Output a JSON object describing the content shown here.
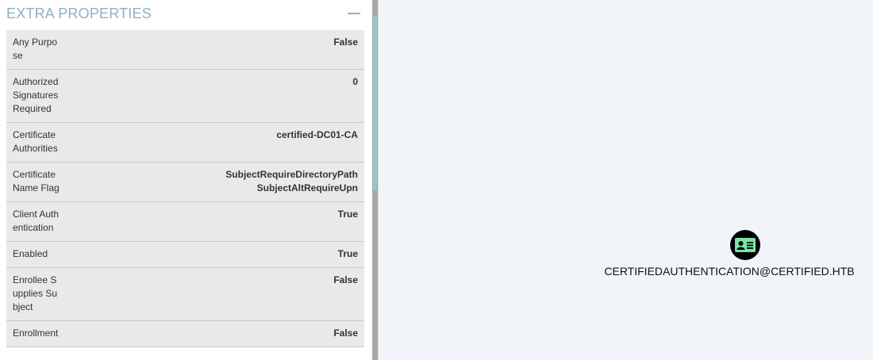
{
  "panel": {
    "section_title": "EXTRA PROPERTIES",
    "collapse_icon": "minus-icon",
    "properties": [
      {
        "key": "Any Purpose",
        "value": [
          "False"
        ]
      },
      {
        "key": "Authorized Signatures Required",
        "value": [
          "0"
        ]
      },
      {
        "key": "Certificate Authorities",
        "value": [
          "certified-DC01-CA"
        ]
      },
      {
        "key": "Certificate Name Flag",
        "value": [
          "SubjectRequireDirectoryPath",
          "SubjectAltRequireUpn"
        ]
      },
      {
        "key": "Client Authentication",
        "value": [
          "True"
        ]
      },
      {
        "key": "Enabled",
        "value": [
          "True"
        ]
      },
      {
        "key": "Enrollee Supplies Subject",
        "value": [
          "False"
        ]
      },
      {
        "key": "Enrollment",
        "value": [
          "False"
        ]
      }
    ]
  },
  "graph": {
    "node": {
      "icon": "id-card-icon",
      "icon_color": "#7be3a4",
      "background": "#000000",
      "label": "CERTIFIEDAUTHENTICATION@CERTIFIED.HTB"
    }
  },
  "colors": {
    "section_title": "#8fb0c1",
    "row_background": "#e9e9e9",
    "graph_background": "#f1f4f9",
    "scroll_thumb": "#94c7c8"
  }
}
